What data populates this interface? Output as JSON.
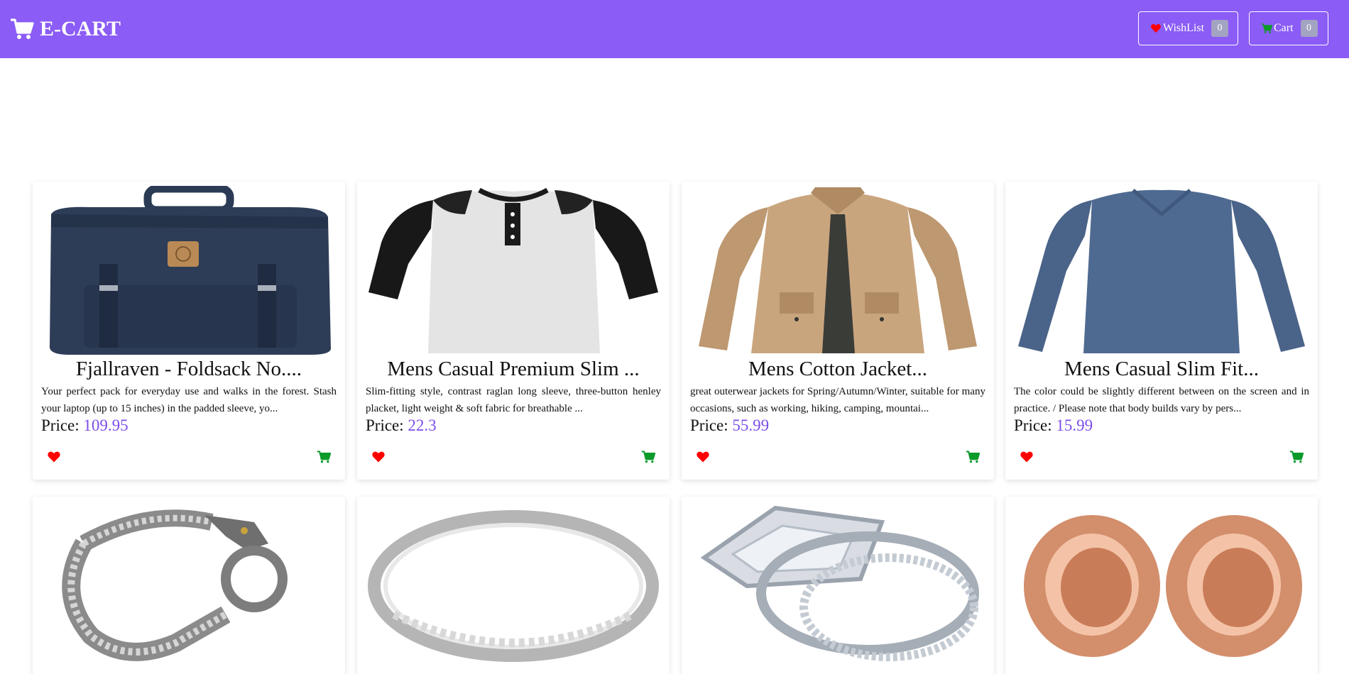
{
  "navbar": {
    "brand": "E-CART",
    "wishlist_label": "WishList",
    "wishlist_count": "0",
    "cart_label": "Cart",
    "cart_count": "0"
  },
  "colors": {
    "navbar": "#8b5cf6",
    "price": "#7c4dea",
    "heart": "#ff0000",
    "cart_icon": "#0a9a2a"
  },
  "price_label": "Price:",
  "products": [
    {
      "title": "Fjallraven - Foldsack No....",
      "description": "Your perfect pack for everyday use and walks in the forest. Stash your laptop (up to 15 inches) in the padded sleeve, yo...",
      "price": "109.95",
      "image": "navy-backpack"
    },
    {
      "title": "Mens Casual Premium Slim ...",
      "description": "Slim-fitting style, contrast raglan long sleeve, three-button henley placket, light weight & soft fabric for breathable ...",
      "price": "22.3",
      "image": "raglan-henley-shirt"
    },
    {
      "title": "Mens Cotton Jacket...",
      "description": "great outerwear jackets for Spring/Autumn/Winter, suitable for many occasions, such as working, hiking, camping, mountai...",
      "price": "55.99",
      "image": "khaki-cotton-jacket"
    },
    {
      "title": "Mens Casual Slim Fit...",
      "description": "The color could be slightly different between on the screen and in practice. / Please note that body builds vary by pers...",
      "price": "15.99",
      "image": "blue-long-sleeve-tshirt"
    },
    {
      "title": "",
      "description": "",
      "price": "",
      "image": "silver-dragon-bracelet"
    },
    {
      "title": "",
      "description": "",
      "price": "",
      "image": "silver-band-ring"
    },
    {
      "title": "",
      "description": "",
      "price": "",
      "image": "diamond-ring-set"
    },
    {
      "title": "",
      "description": "",
      "price": "",
      "image": "rose-gold-ear-plugs"
    }
  ]
}
